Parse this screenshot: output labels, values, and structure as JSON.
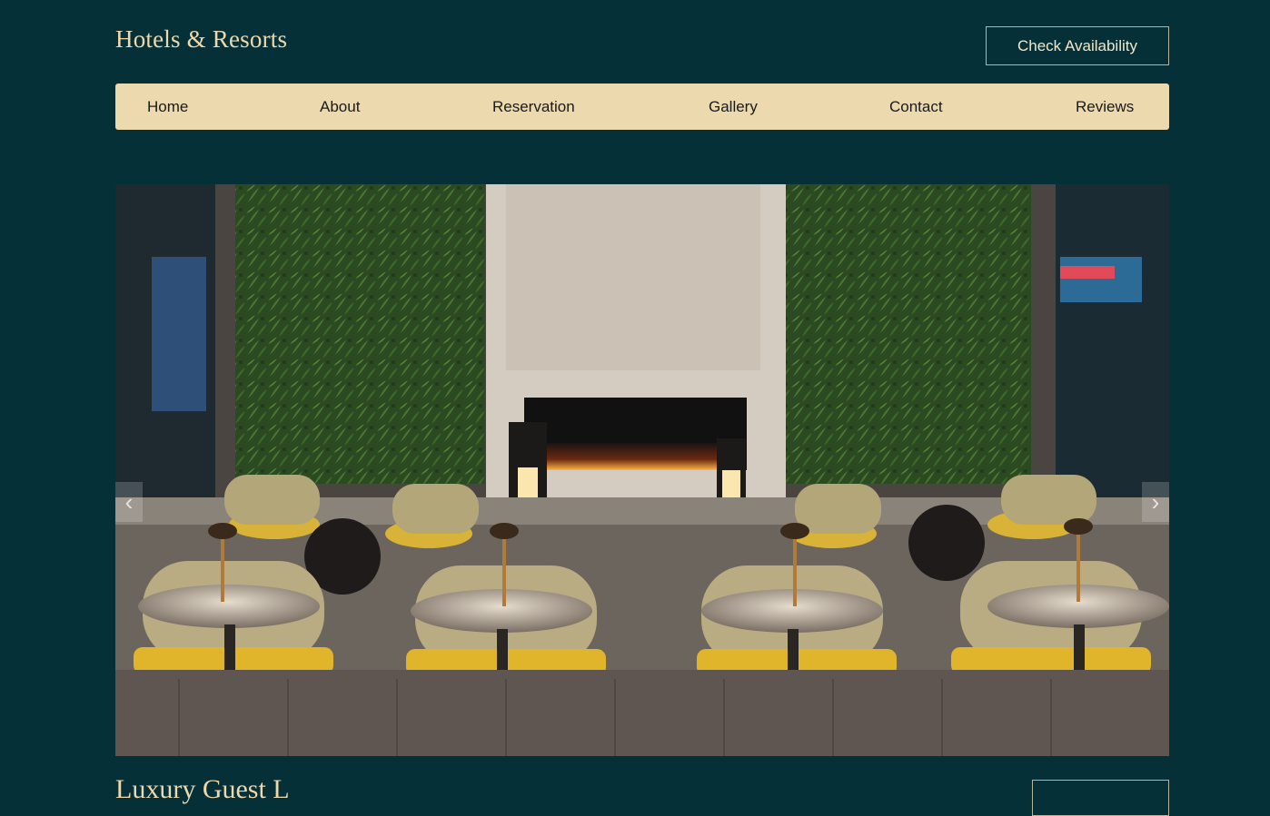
{
  "header": {
    "brand": "Hotels & Resorts",
    "cta_label": "Check Availability"
  },
  "nav": {
    "items": [
      "Home",
      "About",
      "Reservation",
      "Gallery",
      "Contact",
      "Reviews"
    ]
  },
  "hero": {
    "image_subject": "hotel lounge with fireplace and green wall",
    "prev_icon": "chevron-left-icon",
    "next_icon": "chevron-right-icon"
  },
  "section": {
    "heading": "Luxury Guest L"
  },
  "colors": {
    "background": "#063038",
    "accent": "#ecd9ad",
    "nav_text": "#1a1a1a"
  }
}
